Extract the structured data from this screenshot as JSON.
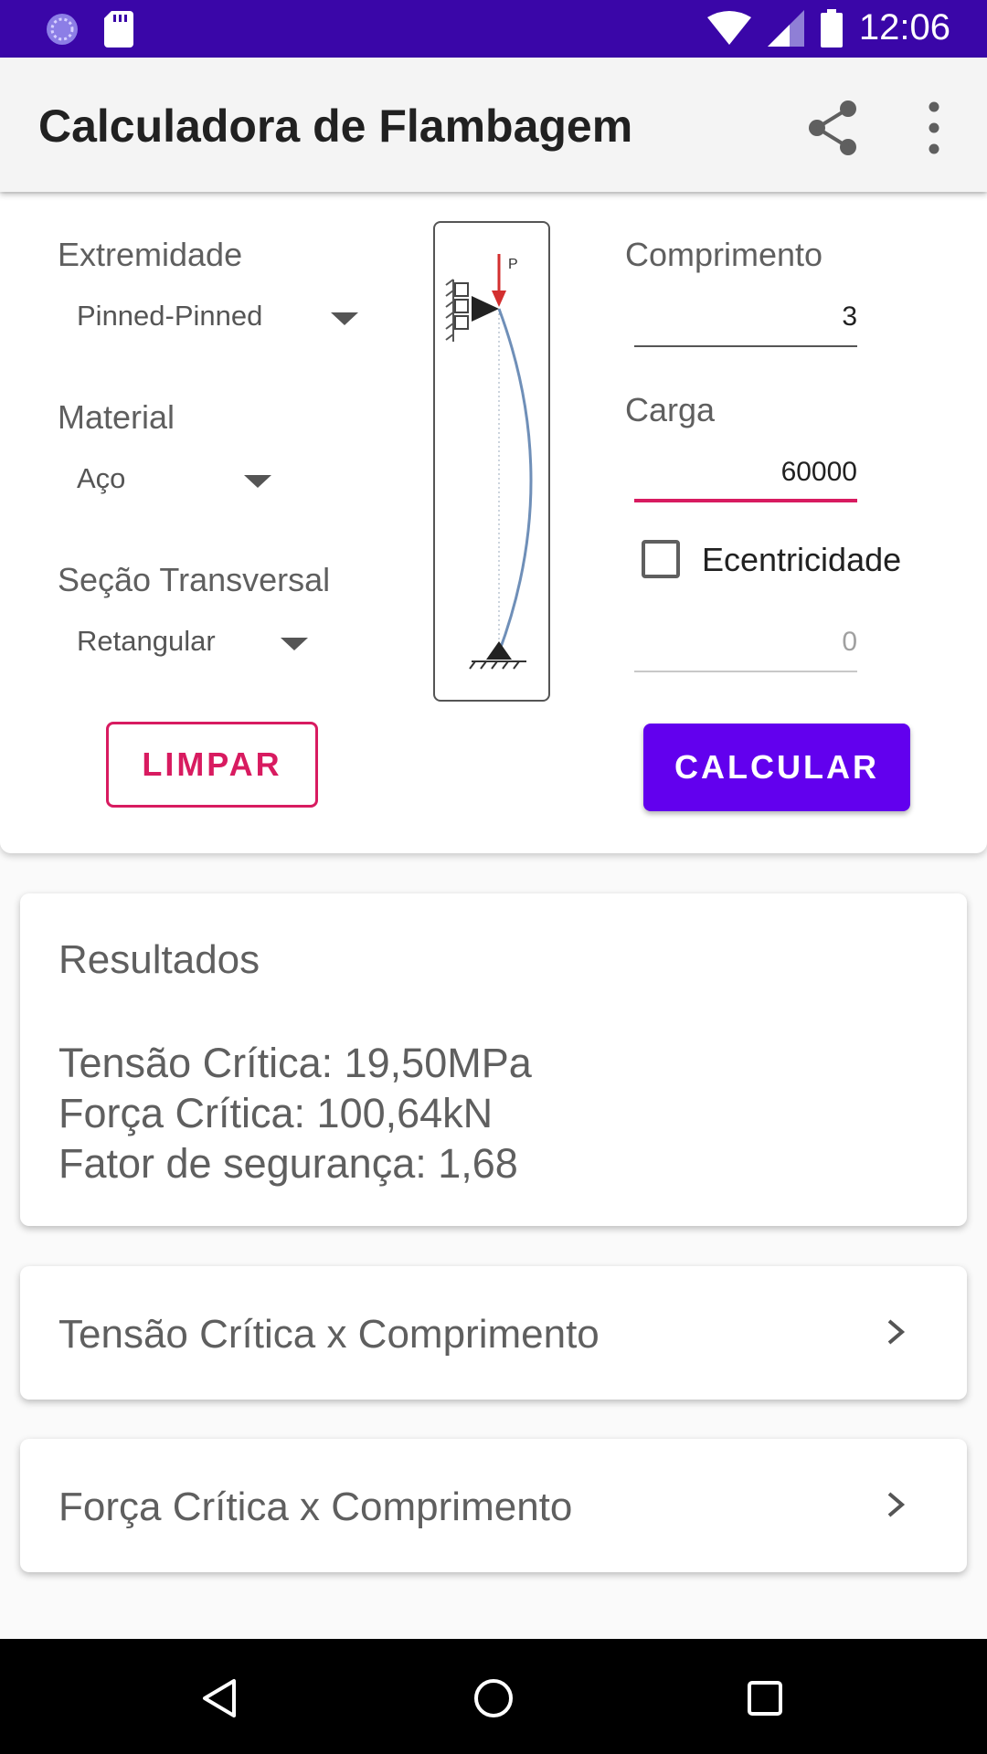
{
  "status_bar": {
    "time": "12:06"
  },
  "app_bar": {
    "title": "Calculadora de Flambagem"
  },
  "inputs": {
    "end_condition": {
      "label": "Extremidade",
      "value": "Pinned-Pinned"
    },
    "material": {
      "label": "Material",
      "value": "Aço"
    },
    "section": {
      "label": "Seção Transversal",
      "value": "Retangular"
    },
    "length": {
      "label": "Comprimento",
      "value": "3"
    },
    "load": {
      "label": "Carga",
      "value": "60000"
    },
    "eccentricity": {
      "label": "Ecentricidade",
      "checked": false,
      "placeholder": "0"
    },
    "diagram": {
      "load_symbol": "P"
    }
  },
  "buttons": {
    "clear": "LIMPAR",
    "calculate": "CALCULAR"
  },
  "results": {
    "title": "Resultados",
    "lines": [
      "Tensão Crítica: 19,50MPa",
      "Força Crítica: 100,64kN",
      "Fator de segurança: 1,68"
    ]
  },
  "links": [
    {
      "label": "Tensão Crítica x Comprimento"
    },
    {
      "label": "Força Crítica x Comprimento"
    }
  ],
  "colors": {
    "status_bar": "#3a06a8",
    "primary": "#6200ee",
    "accent": "#d81b60"
  }
}
